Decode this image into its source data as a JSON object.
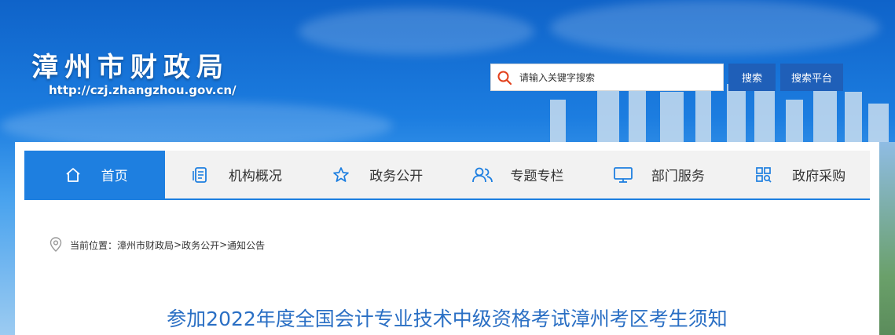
{
  "header": {
    "site_title": "漳州市财政局",
    "site_url": "http://czj.zhangzhou.gov.cn/",
    "search_placeholder": "请输入关键字搜索",
    "search_button": "搜索",
    "platform_button": "搜索平台"
  },
  "nav": {
    "items": [
      {
        "label": "首页",
        "icon": "home-icon",
        "active": true
      },
      {
        "label": "机构概况",
        "icon": "document-icon"
      },
      {
        "label": "政务公开",
        "icon": "star-icon"
      },
      {
        "label": "专题专栏",
        "icon": "users-icon"
      },
      {
        "label": "部门服务",
        "icon": "monitor-icon"
      },
      {
        "label": "政府采购",
        "icon": "grid-search-icon"
      }
    ]
  },
  "breadcrumb": {
    "prefix": "当前位置：",
    "items": [
      "漳州市财政局",
      "政务公开",
      "通知公告"
    ],
    "separator": ">"
  },
  "article": {
    "title": "参加2022年度全国会计专业技术中级资格考试漳州考区考生须知"
  },
  "colors": {
    "accent": "#1e7fe0",
    "button": "#1f5fb8",
    "title": "#2a6fc4"
  }
}
